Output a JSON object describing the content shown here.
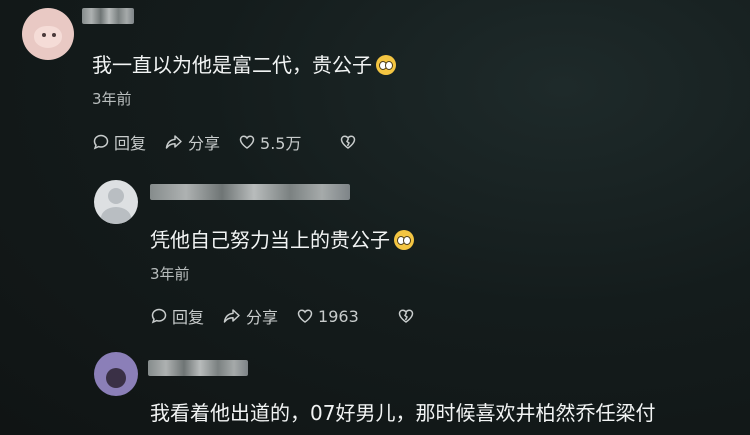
{
  "comments": [
    {
      "text": "我一直以为他是富二代，贵公子",
      "time": "3年前",
      "reply_label": "回复",
      "share_label": "分享",
      "likes": "5.5万"
    },
    {
      "text": "凭他自己努力当上的贵公子",
      "time": "3年前",
      "reply_label": "回复",
      "share_label": "分享",
      "likes": "1963"
    },
    {
      "text": "我看着他出道的，07好男儿，那时候喜欢井柏然乔任梁付"
    }
  ],
  "icons": {
    "reply": "comment-bubble-icon",
    "share": "share-arrow-icon",
    "like": "heart-icon",
    "dislike": "broken-heart-icon",
    "emoji": "pleading-face-emoji"
  }
}
